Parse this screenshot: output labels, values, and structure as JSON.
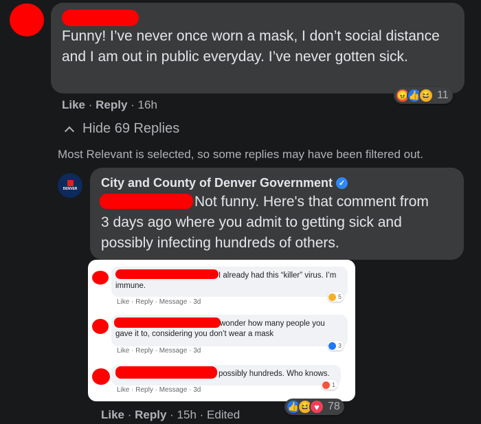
{
  "comment1": {
    "text": "Funny! I’ve never once worn a mask, I don’t social distance and I am out in public everyday. I’ve never gotten sick.",
    "actions": {
      "like": "Like",
      "reply": "Reply",
      "time": "16h"
    },
    "reactions": {
      "count": "11",
      "icons": [
        "angry-icon",
        "like-icon",
        "haha-icon"
      ]
    }
  },
  "hide_replies": "Hide 69 Replies",
  "filter_notice": "Most Relevant is selected, so some replies may have been filtered out.",
  "reply": {
    "avatar_text": "DENVER",
    "author": "City and County of Denver Government",
    "text_line1": "Not funny. Here's that comment from",
    "text_rest": "3 days ago where you admit to getting sick and possibly infecting hundreds of others.",
    "actions": {
      "like": "Like",
      "reply": "Reply",
      "time": "15h",
      "edited": "Edited"
    },
    "reactions": {
      "count": "78",
      "icons": [
        "like-icon",
        "haha-icon",
        "love-icon"
      ]
    }
  },
  "embedded": {
    "comments": [
      {
        "text_a": "I already had this “killer” virus. I’m",
        "text_b": "immune.",
        "reaction_count": "5",
        "reaction": "haha"
      },
      {
        "text_a": "wonder how many people you",
        "text_b": "gave it to, considering you don’t wear a mask",
        "reaction_count": "3",
        "reaction": "like"
      },
      {
        "text_a": "possibly hundreds. Who knows.",
        "text_b": "",
        "reaction_count": "1",
        "reaction": "angry"
      }
    ],
    "actions": {
      "like": "Like",
      "reply": "Reply",
      "message": "Message",
      "time": "3d"
    }
  },
  "colors": {
    "background": "#18191a",
    "bubble": "#3a3b3c",
    "accent": "#2078f4",
    "redaction": "#ff0000"
  }
}
